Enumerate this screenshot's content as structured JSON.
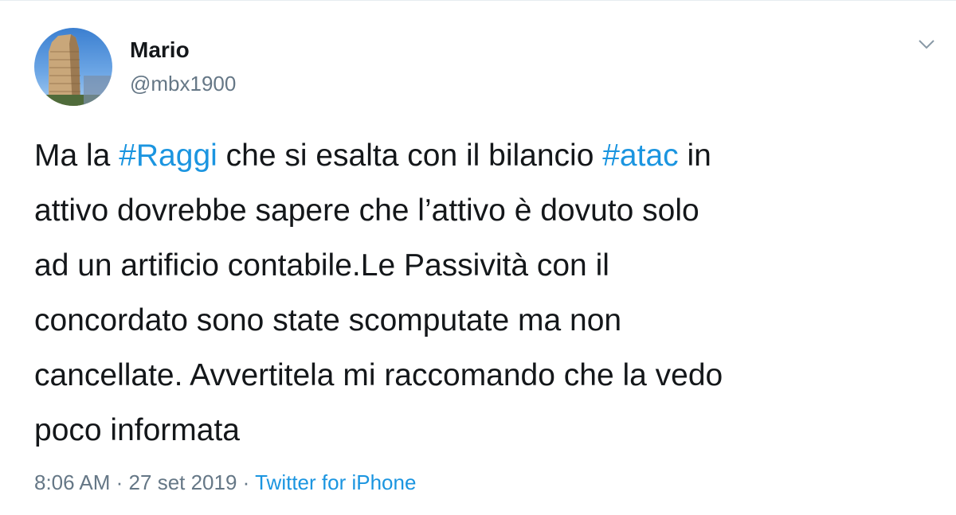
{
  "user": {
    "display_name": "Mario",
    "handle": "@mbx1900",
    "avatar_icon": "avatar-flatiron-building"
  },
  "tweet": {
    "lines": [
      [
        {
          "text": "Ma la ",
          "type": "text"
        },
        {
          "text": "#Raggi",
          "type": "hashtag"
        },
        {
          "text": " che si esalta con il bilancio ",
          "type": "text"
        },
        {
          "text": "#atac",
          "type": "hashtag"
        },
        {
          "text": " in",
          "type": "text"
        }
      ],
      [
        {
          "text": "attivo dovrebbe sapere che l’attivo è dovuto solo",
          "type": "text"
        }
      ],
      [
        {
          "text": "ad un artificio contabile.Le Passività con il",
          "type": "text"
        }
      ],
      [
        {
          "text": "concordato sono state scomputate ma non",
          "type": "text"
        }
      ],
      [
        {
          "text": "cancellate. Avvertitela mi raccomando che la vedo",
          "type": "text"
        }
      ],
      [
        {
          "text": "poco informata",
          "type": "text"
        }
      ]
    ]
  },
  "meta": {
    "time": "8:06 AM",
    "separator": "·",
    "date": "27 set 2019",
    "source": "Twitter for iPhone"
  },
  "colors": {
    "text": "#14171a",
    "secondary": "#657786",
    "link": "#1b95e0",
    "border": "#e6ecf0"
  },
  "icons": {
    "menu": "chevron-down-icon"
  }
}
